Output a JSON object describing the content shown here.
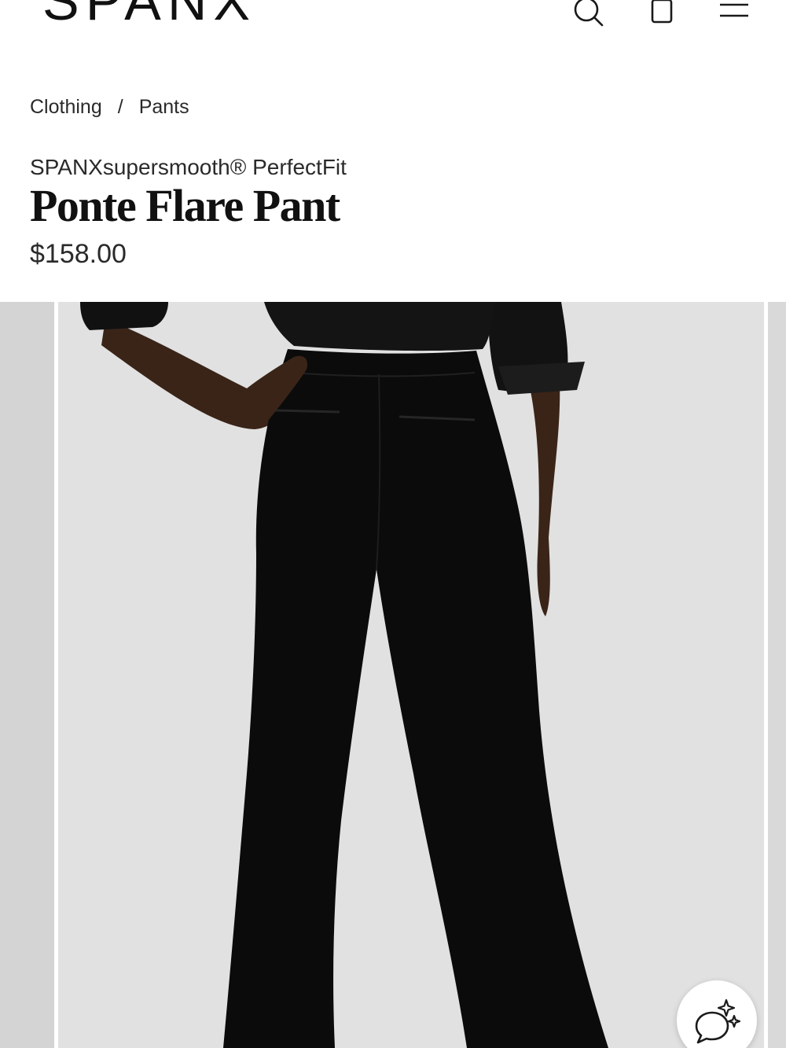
{
  "brand": {
    "logo_text": "SPANX"
  },
  "header": {
    "icons": [
      "search-icon",
      "shopping-bag-icon",
      "menu-icon"
    ]
  },
  "breadcrumb": {
    "items": [
      {
        "label": "Clothing"
      },
      {
        "label": "Pants"
      }
    ],
    "separator": "/"
  },
  "product": {
    "collection": "SPANXsupersmooth® PerfectFit",
    "title": "Ponte Flare Pant",
    "price": "$158.00"
  },
  "gallery": {
    "background_color": "#e3e3e3",
    "garment_color": "#0b0b0b"
  },
  "assistant": {
    "icon": "chat-sparkle-icon"
  }
}
